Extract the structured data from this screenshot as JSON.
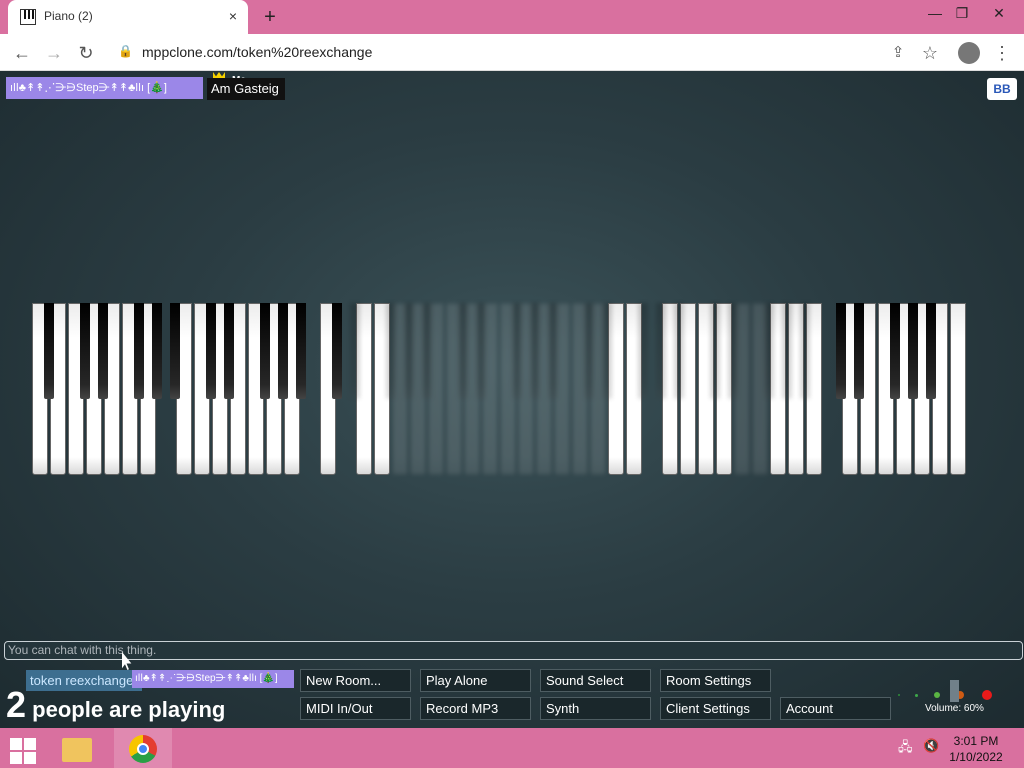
{
  "browser": {
    "tab_title": "Piano (2)",
    "tab_close_icon": "×",
    "new_tab_icon": "+",
    "minimize_icon": "—",
    "maximize_icon": "❐",
    "close_icon": "✕",
    "url": "mppclone.com/token%20reexchange"
  },
  "top_users": {
    "other_user": "ıǀǀ♣↟↟⋰⋺⋻Step⋺↟↟♣ǀǀı [🎄]",
    "me_tag": "Me",
    "me_name": "Am Gasteig",
    "bb_button": "BB"
  },
  "chat": {
    "placeholder": "You can chat with this thing."
  },
  "room": {
    "token_label": "token reexchange",
    "user_label": "ıǀǀ♣↟↟⋰⋺⋻Step⋺↟↟♣ǀǀı [🎄]",
    "people_count": "2",
    "people_text": "people are playing"
  },
  "buttons": {
    "new_room": "New Room...",
    "play_alone": "Play Alone",
    "sound_select": "Sound Select",
    "room_settings": "Room Settings",
    "midi_inout": "MIDI In/Out",
    "record_mp3": "Record MP3",
    "synth": "Synth",
    "client_settings": "Client Settings",
    "account": "Account"
  },
  "volume": {
    "label": "Volume: 60%",
    "percent": 60,
    "meter_colors": [
      "#2f8f39",
      "#3da84a",
      "#5ab543",
      "#cf5b14",
      "#ea1a1a"
    ]
  },
  "taskbar": {
    "time": "3:01 PM",
    "date": "1/10/2022"
  },
  "colors": {
    "chrome_pink": "#d9709f",
    "user_purple": "#9b87e8",
    "bb_blue": "#2a58b8",
    "token_blue": "#3d6e8f"
  }
}
